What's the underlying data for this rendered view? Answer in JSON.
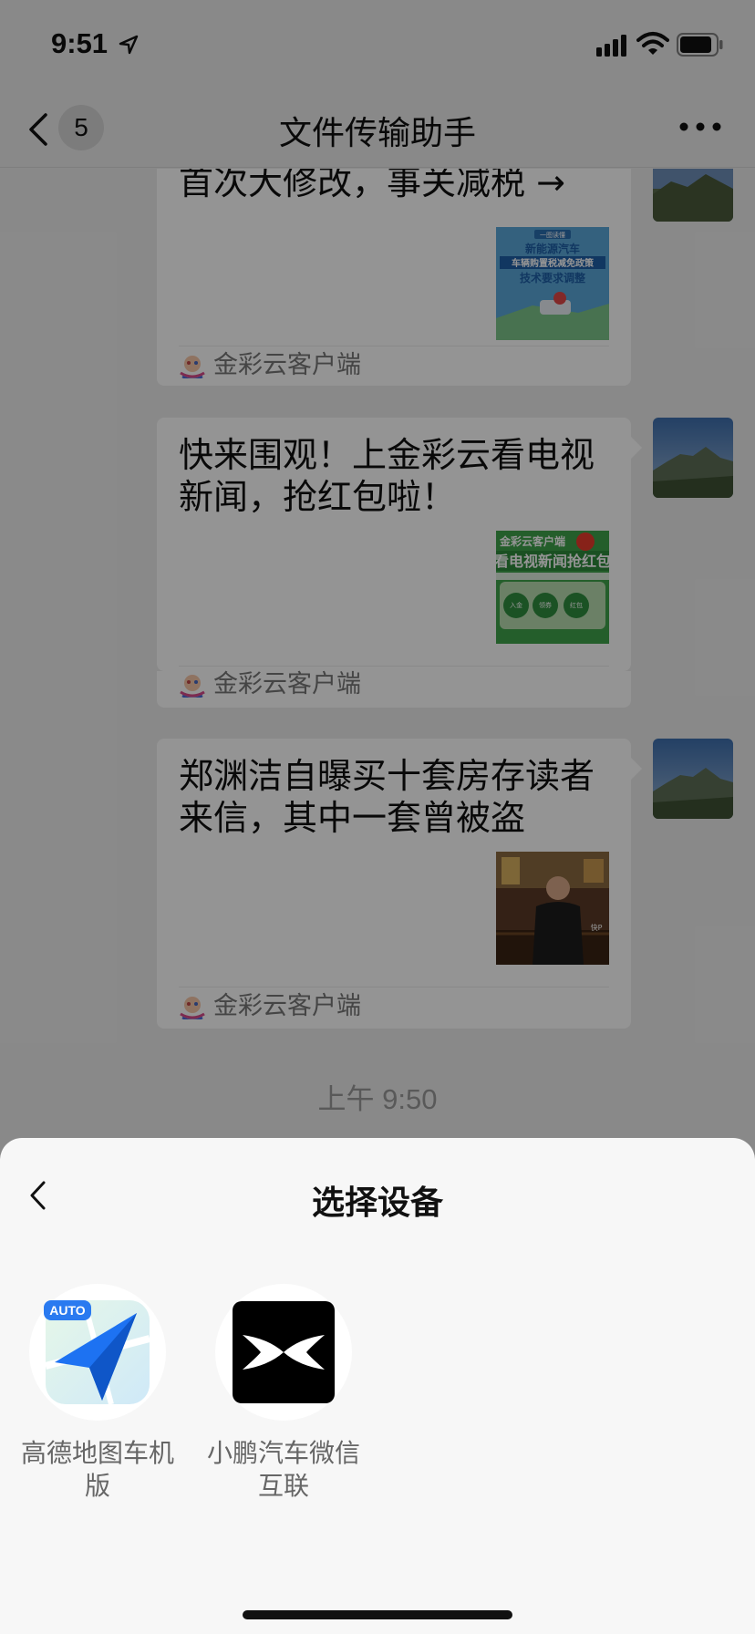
{
  "status_bar": {
    "time": "9:51"
  },
  "nav": {
    "back_count": "5",
    "title": "文件传输助手"
  },
  "messages": [
    {
      "title": "首次大修改，事关减税 →",
      "source": "金彩云客户端"
    },
    {
      "title": "快来围观！上金彩云看电视新闻，抢红包啦！",
      "source": "金彩云客户端"
    },
    {
      "title": "郑渊洁自曝买十套房存读者来信，其中一套曾被盗",
      "source": "金彩云客户端"
    }
  ],
  "thumb_texts": {
    "news1_a": "一图读懂",
    "news1_b": "新能源汽车",
    "news1_c": "车辆购置税减免政策",
    "news1_d": "技术要求调整",
    "news2_a": "金彩云客户端",
    "news2_b": "看电视新闻抢红包",
    "news2_c1": "入金",
    "news2_c2": "领券",
    "news2_c3": "红包",
    "news3_badge": "快P"
  },
  "timestamp": "上午 9:50",
  "sheet": {
    "title": "选择设备",
    "devices": [
      {
        "label": "高德地图车机版",
        "badge": "AUTO"
      },
      {
        "label": "小鹏汽车微信互联"
      }
    ]
  }
}
